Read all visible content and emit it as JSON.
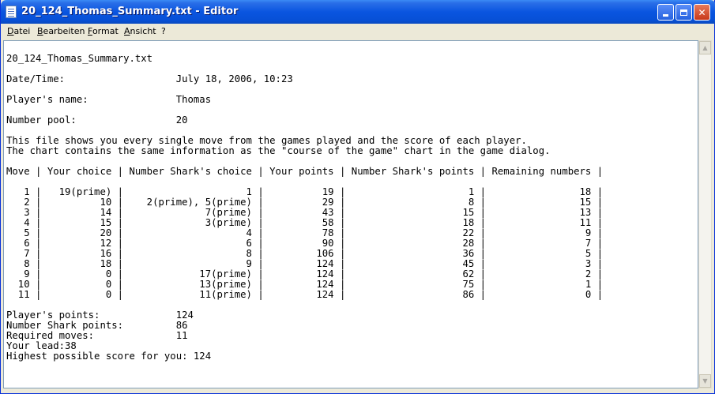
{
  "window": {
    "title": "20_124_Thomas_Summary.txt - Editor",
    "controls": {
      "minimize": "",
      "maximize": "",
      "close": "✕"
    }
  },
  "menubar": {
    "items": [
      "Datei",
      "Bearbeiten",
      "Format",
      "Ansicht",
      "?"
    ]
  },
  "document": {
    "text": "\n20_124_Thomas_Summary.txt\n\nDate/Time:                   July 18, 2006, 10:23\n\nPlayer's name:               Thomas\n\nNumber pool:                 20\n\nThis file shows you every single move from the games played and the score of each player.\nThe chart contains the same information as the \"course of the game\" chart in the game dialog.\n\nMove | Your choice | Number Shark's choice | Your points | Number Shark's points | Remaining numbers |\n\n   1 |   19(prime) |                     1 |          19 |                     1 |                18 |\n   2 |          10 |    2(prime), 5(prime) |          29 |                     8 |                15 |\n   3 |          14 |              7(prime) |          43 |                    15 |                13 |\n   4 |          15 |              3(prime) |          58 |                    18 |                11 |\n   5 |          20 |                     4 |          78 |                    22 |                 9 |\n   6 |          12 |                     6 |          90 |                    28 |                 7 |\n   7 |          16 |                     8 |         106 |                    36 |                 5 |\n   8 |          18 |                     9 |         124 |                    45 |                 3 |\n   9 |           0 |             17(prime) |         124 |                    62 |                 2 |\n  10 |           0 |             13(prime) |         124 |                    75 |                 1 |\n  11 |           0 |             11(prime) |         124 |                    86 |                 0 |\n\nPlayer's points:             124\nNumber Shark points:         86\nRequired moves:              11\nYour lead:38\nHighest possible score for you: 124"
  },
  "colors": {
    "titlebar": "#0a55e0",
    "close_button": "#c8391a",
    "window_frame": "#ece9d8"
  },
  "icons": {
    "app": "notepad-icon",
    "scroll_up": "arrow-up-icon",
    "scroll_down": "arrow-down-icon"
  }
}
